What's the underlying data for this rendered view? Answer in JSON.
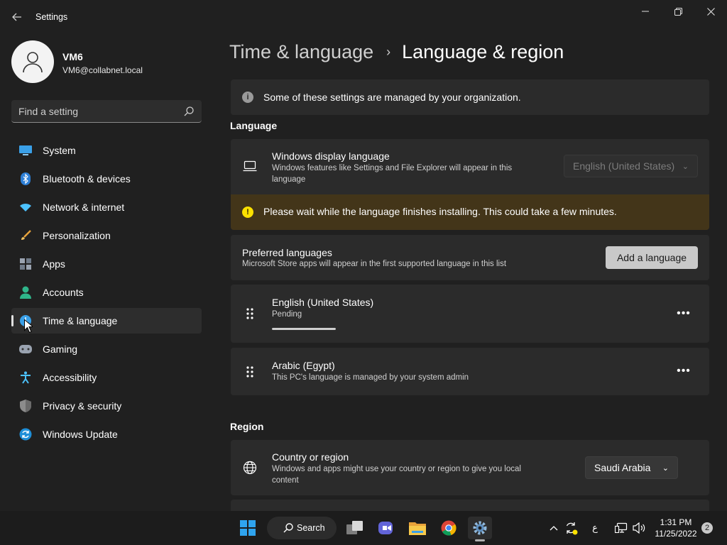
{
  "window": {
    "title": "Settings",
    "back_icon": "back-arrow-icon",
    "controls": [
      "minimize-icon",
      "maximize-icon",
      "close-icon"
    ]
  },
  "profile": {
    "name": "VM6",
    "email": "VM6@collabnet.local",
    "avatar_icon": "person-icon"
  },
  "search": {
    "placeholder": "Find a setting",
    "icon": "search-icon"
  },
  "sidebar": {
    "items": [
      {
        "label": "System",
        "icon": "system-icon",
        "active": false
      },
      {
        "label": "Bluetooth & devices",
        "icon": "bluetooth-icon",
        "active": false
      },
      {
        "label": "Network & internet",
        "icon": "wifi-icon",
        "active": false
      },
      {
        "label": "Personalization",
        "icon": "brush-icon",
        "active": false
      },
      {
        "label": "Apps",
        "icon": "apps-icon",
        "active": false
      },
      {
        "label": "Accounts",
        "icon": "accounts-icon",
        "active": false
      },
      {
        "label": "Time & language",
        "icon": "time-language-icon",
        "active": true
      },
      {
        "label": "Gaming",
        "icon": "gamepad-icon",
        "active": false
      },
      {
        "label": "Accessibility",
        "icon": "accessibility-icon",
        "active": false
      },
      {
        "label": "Privacy & security",
        "icon": "shield-icon",
        "active": false
      },
      {
        "label": "Windows Update",
        "icon": "update-icon",
        "active": false
      }
    ]
  },
  "breadcrumb": {
    "parent": "Time & language",
    "separator": "›",
    "current": "Language & region"
  },
  "info_bar": {
    "text": "Some of these settings are managed by your organization.",
    "icon": "info-icon"
  },
  "language_section": {
    "title": "Language",
    "display_language": {
      "title": "Windows display language",
      "description": "Windows features like Settings and File Explorer will appear in this language",
      "dropdown_value": "English (United States)",
      "icon": "laptop-icon"
    },
    "warning": {
      "text": "Please wait while the language finishes installing. This could take a few minutes.",
      "icon": "warning-icon"
    },
    "preferred": {
      "title": "Preferred languages",
      "description": "Microsoft Store apps will appear in the first supported language in this list",
      "add_button": "Add a language"
    },
    "languages": [
      {
        "name": "English (United States)",
        "status": "Pending",
        "progress": 1.0,
        "more_icon": "more-options-icon"
      },
      {
        "name": "Arabic (Egypt)",
        "status": "This PC's language is managed by your system admin",
        "more_icon": "more-options-icon"
      }
    ]
  },
  "region_section": {
    "title": "Region",
    "country": {
      "title": "Country or region",
      "description": "Windows and apps might use your country or region to give you local content",
      "dropdown_value": "Saudi Arabia",
      "icon": "globe-icon"
    }
  },
  "taskbar": {
    "search_label": "Search",
    "apps": [
      "start-icon",
      "task-view-icon",
      "teams-icon",
      "file-explorer-icon",
      "chrome-icon",
      "settings-icon"
    ],
    "tray": {
      "language_indicator": "ع",
      "time": "1:31 PM",
      "date": "11/25/2022",
      "notification_count": "2"
    }
  },
  "colors": {
    "background": "#202020",
    "card": "#2b2b2b",
    "warning_bar": "#433519",
    "warning_icon": "#fce100",
    "accent_blue": "#4cc2ff",
    "taskbar": "#1c1c1c"
  }
}
